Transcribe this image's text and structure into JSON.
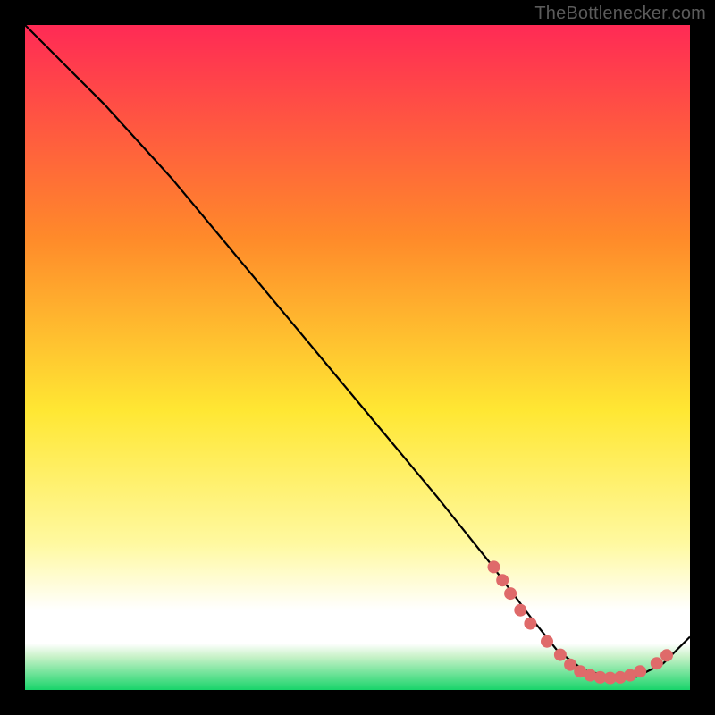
{
  "watermark": "TheBottlenecker.com",
  "colors": {
    "top": "#ff2a55",
    "mid_upper": "#ff8a2a",
    "mid": "#ffe733",
    "mid_lower": "#fff9a0",
    "white_band": "#ffffff",
    "green": "#18d46a",
    "curve": "#000000",
    "marker_fill": "#df6a6a",
    "marker_stroke": "#df6a6a"
  },
  "chart_data": {
    "type": "line",
    "title": "",
    "xlabel": "",
    "ylabel": "",
    "xlim": [
      0,
      100
    ],
    "ylim": [
      0,
      100
    ],
    "series": [
      {
        "name": "curve",
        "x": [
          0,
          6,
          12,
          22,
          32,
          42,
          52,
          62,
          70,
          76,
          80,
          84,
          88,
          92,
          96,
          100
        ],
        "y": [
          100,
          94,
          88,
          77,
          65,
          53,
          41,
          29,
          19,
          11,
          6,
          3,
          2,
          2,
          4,
          8
        ]
      }
    ],
    "markers": [
      {
        "x": 70.5,
        "y": 18.5
      },
      {
        "x": 71.8,
        "y": 16.5
      },
      {
        "x": 73.0,
        "y": 14.5
      },
      {
        "x": 74.5,
        "y": 12.0
      },
      {
        "x": 76.0,
        "y": 10.0
      },
      {
        "x": 78.5,
        "y": 7.3
      },
      {
        "x": 80.5,
        "y": 5.3
      },
      {
        "x": 82.0,
        "y": 3.8
      },
      {
        "x": 83.5,
        "y": 2.8
      },
      {
        "x": 85.0,
        "y": 2.2
      },
      {
        "x": 86.5,
        "y": 1.9
      },
      {
        "x": 88.0,
        "y": 1.8
      },
      {
        "x": 89.5,
        "y": 1.9
      },
      {
        "x": 91.0,
        "y": 2.2
      },
      {
        "x": 92.5,
        "y": 2.8
      },
      {
        "x": 95.0,
        "y": 4.0
      },
      {
        "x": 96.5,
        "y": 5.2
      }
    ]
  }
}
